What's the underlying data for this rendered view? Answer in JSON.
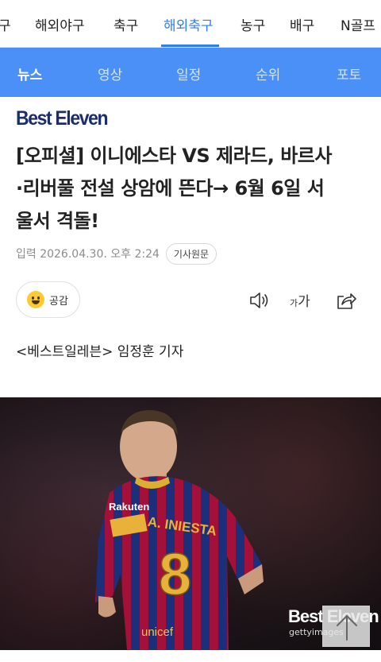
{
  "sport_nav": {
    "items": [
      "구",
      "해외야구",
      "축구",
      "해외축구",
      "농구",
      "배구",
      "N골프"
    ],
    "active": "해외축구"
  },
  "sub_nav": {
    "tabs": [
      "뉴스",
      "영상",
      "일정",
      "순위",
      "포토"
    ],
    "active": "뉴스"
  },
  "article": {
    "brand": "Best Eleven",
    "headline_lines": [
      "[오피셜] 이니에스타 VS 제라드, 바르사",
      "·리버풀 전설 상암에 뜬다→ 6월 6일 서",
      "울서 격돌!"
    ],
    "date": "입력 2026.04.30. 오후 2:24",
    "original_button": "기사원문",
    "reaction_label": "공감",
    "font_small": "가",
    "font_big": "가",
    "reporter": "<베스트일레븐> 임정훈 기자"
  },
  "photo": {
    "jersey_name": "A. INIESTA",
    "jersey_number": "8",
    "sponsor": "unicef",
    "brand_badge": "Rakuten",
    "watermark": "Best Eleven",
    "credit": "gettyimages"
  },
  "colors": {
    "accent": "#2f7ef1",
    "subnav_bg": "#4a90f6",
    "brand": "#1b2d6b"
  }
}
